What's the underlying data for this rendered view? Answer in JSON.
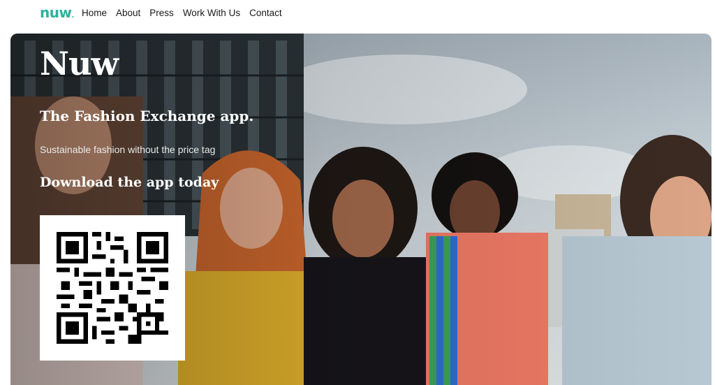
{
  "nav": {
    "logo": "nuw",
    "logo_dot": ".",
    "items": [
      "Home",
      "About",
      "Press",
      "Work With Us",
      "Contact"
    ]
  },
  "hero": {
    "title": "Nuw",
    "subtitle": "The Fashion Exchange app.",
    "tagline": "Sustainable fashion without the price tag",
    "cta": "Download the app today",
    "qr_icon": "qr-code-icon",
    "photo_description_icon": "group-photo-icon"
  },
  "colors": {
    "brand": "#2bb39a",
    "nav_text": "#1a1a1a",
    "hero_text": "#ffffff"
  }
}
